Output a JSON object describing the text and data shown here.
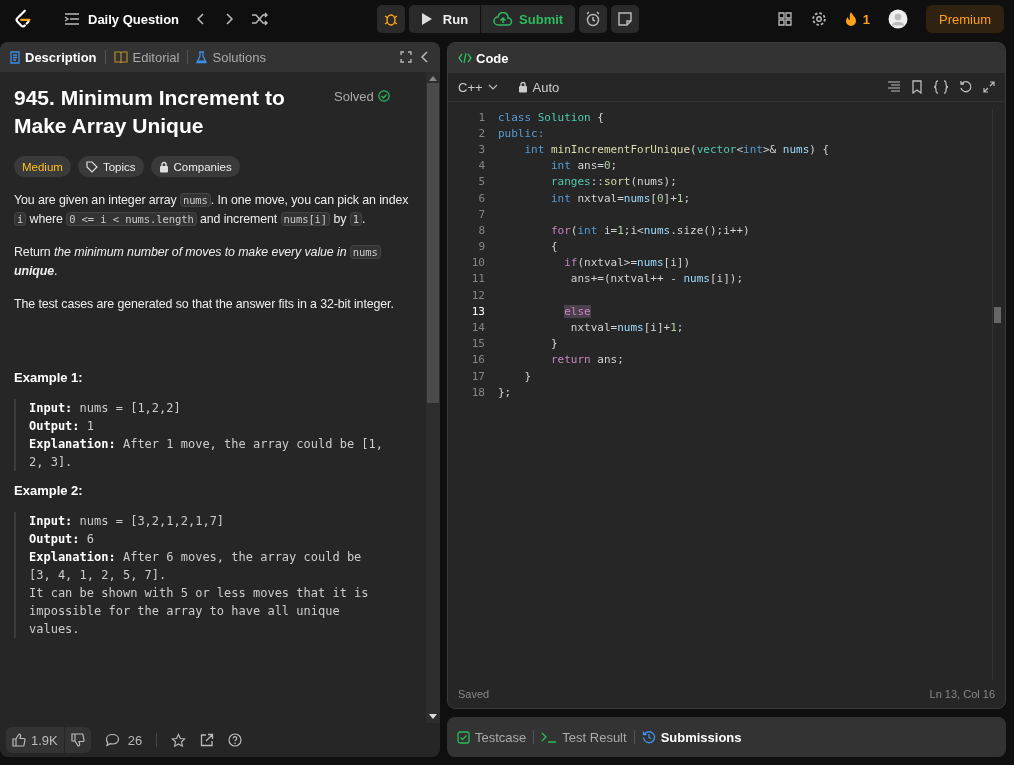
{
  "topbar": {
    "title": "Daily Question",
    "run": "Run",
    "submit": "Submit",
    "streak": "1",
    "premium": "Premium"
  },
  "description": {
    "tabs": [
      {
        "label": "Description",
        "selected": true
      },
      {
        "label": "Editorial",
        "selected": false
      },
      {
        "label": "Solutions",
        "selected": false
      }
    ],
    "title": "945. Minimum Increment to Make Array Unique",
    "status": "Solved",
    "tags": [
      {
        "label": "Medium",
        "kind": "difficulty"
      },
      {
        "label": "Topics",
        "kind": "topic"
      },
      {
        "label": "Companies",
        "kind": "locked"
      }
    ],
    "paragraphs": [
      [
        {
          "t": "You are given an integer array ",
          "kind": "text"
        },
        {
          "t": "nums",
          "kind": "code"
        },
        {
          "t": ". In one move, you can pick an index ",
          "kind": "text"
        },
        {
          "t": "i",
          "kind": "code"
        },
        {
          "t": " where ",
          "kind": "text"
        },
        {
          "t": "0 <= i < nums.length",
          "kind": "code"
        },
        {
          "t": " and increment ",
          "kind": "text"
        },
        {
          "t": "nums[i]",
          "kind": "code"
        },
        {
          "t": " by ",
          "kind": "text"
        },
        {
          "t": "1",
          "kind": "code"
        },
        {
          "t": ".",
          "kind": "text"
        }
      ],
      [
        {
          "t": "Return *the minimum number of moves to make every value in* ",
          "kind": "text"
        },
        {
          "t": "nums",
          "kind": "code"
        },
        {
          "t": " **unique**.",
          "kind": "text"
        }
      ],
      [
        {
          "t": "The test cases are generated so that the answer fits in a 32-bit integer.",
          "kind": "text"
        }
      ]
    ],
    "examples": [
      {
        "title": "Example 1:",
        "lines": [
          {
            "label": "Input:",
            "value": "nums = [1,2,2]"
          },
          {
            "label": "Output:",
            "value": "1"
          },
          {
            "label": "Explanation:",
            "value": "After 1 move, the array could be [1, 2, 3]."
          }
        ]
      },
      {
        "title": "Example 2:",
        "lines": [
          {
            "label": "Input:",
            "value": "nums = [3,2,1,2,1,7]"
          },
          {
            "label": "Output:",
            "value": "6"
          },
          {
            "label": "Explanation:",
            "value": "After 6 moves, the array could be [3, 4, 1, 2, 5, 7].\nIt can be shown with 5 or less moves that it is impossible for the array to have all unique values."
          }
        ]
      }
    ],
    "likes": "1.9K",
    "comments": "26"
  },
  "editor": {
    "title": "Code",
    "language": "C++",
    "mode": "Auto",
    "lines": [
      {
        "n": "1",
        "current": false,
        "tokens": [
          {
            "t": "class",
            "kind": "kw"
          },
          {
            "t": " Solution",
            "kind": "type"
          },
          {
            "t": " {",
            "kind": "plain"
          }
        ]
      },
      {
        "n": "2",
        "current": false,
        "tokens": [
          {
            "t": "public:",
            "kind": "kw"
          }
        ]
      },
      {
        "n": "3",
        "current": false,
        "tokens": [
          {
            "t": "    int",
            "kind": "kw"
          },
          {
            "t": " minIncrementForUnique",
            "kind": "fn"
          },
          {
            "t": "(",
            "kind": "plain"
          },
          {
            "t": "vector",
            "kind": "type"
          },
          {
            "t": "<",
            "kind": "plain"
          },
          {
            "t": "int",
            "kind": "kw"
          },
          {
            "t": ">& ",
            "kind": "plain"
          },
          {
            "t": "nums",
            "kind": "var"
          },
          {
            "t": ") {",
            "kind": "plain"
          }
        ]
      },
      {
        "n": "4",
        "current": false,
        "tokens": [
          {
            "t": "        int",
            "kind": "kw"
          },
          {
            "t": " ans=",
            "kind": "plain"
          },
          {
            "t": "0",
            "kind": "num"
          },
          {
            "t": ";",
            "kind": "plain"
          }
        ]
      },
      {
        "n": "5",
        "current": false,
        "tokens": [
          {
            "t": "        ranges",
            "kind": "type"
          },
          {
            "t": "::",
            "kind": "plain"
          },
          {
            "t": "sort",
            "kind": "fn"
          },
          {
            "t": "(nums);",
            "kind": "plain"
          }
        ]
      },
      {
        "n": "6",
        "current": false,
        "tokens": [
          {
            "t": "        int",
            "kind": "kw"
          },
          {
            "t": " nxtval=",
            "kind": "plain"
          },
          {
            "t": "nums",
            "kind": "var"
          },
          {
            "t": "[",
            "kind": "plain"
          },
          {
            "t": "0",
            "kind": "num"
          },
          {
            "t": "]+",
            "kind": "plain"
          },
          {
            "t": "1",
            "kind": "num"
          },
          {
            "t": ";",
            "kind": "plain"
          }
        ]
      },
      {
        "n": "7",
        "current": false
      },
      {
        "n": "8",
        "current": false,
        "tokens": [
          {
            "t": "        for",
            "kind": "ctrl"
          },
          {
            "t": "(",
            "kind": "plain"
          },
          {
            "t": "int",
            "kind": "kw"
          },
          {
            "t": " i=",
            "kind": "plain"
          },
          {
            "t": "1",
            "kind": "num"
          },
          {
            "t": ";i<",
            "kind": "plain"
          },
          {
            "t": "nums",
            "kind": "var"
          },
          {
            "t": ".size();i++)",
            "kind": "plain"
          }
        ]
      },
      {
        "n": "9",
        "current": false,
        "tokens": [
          {
            "t": "        {",
            "kind": "plain"
          }
        ]
      },
      {
        "n": "10",
        "current": false,
        "tokens": [
          {
            "t": "          if",
            "kind": "ctrl"
          },
          {
            "t": "(nxtval>=",
            "kind": "plain"
          },
          {
            "t": "nums",
            "kind": "var"
          },
          {
            "t": "[i])",
            "kind": "plain"
          }
        ]
      },
      {
        "n": "11",
        "current": false,
        "tokens": [
          {
            "t": "           ans+=(nxtval++ - ",
            "kind": "plain"
          },
          {
            "t": "nums",
            "kind": "var"
          },
          {
            "t": "[i]);",
            "kind": "plain"
          }
        ]
      },
      {
        "n": "12",
        "current": false
      },
      {
        "n": "13",
        "current": true,
        "tokens": [
          {
            "t": "else",
            "kind": "ctrl"
          }
        ]
      },
      {
        "n": "14",
        "current": false,
        "tokens": [
          {
            "t": "           nxtval=",
            "kind": "plain"
          },
          {
            "t": "nums",
            "kind": "var"
          },
          {
            "t": "[i]+",
            "kind": "plain"
          },
          {
            "t": "1",
            "kind": "num"
          },
          {
            "t": ";",
            "kind": "plain"
          }
        ]
      },
      {
        "n": "15",
        "current": false,
        "tokens": [
          {
            "t": "        }",
            "kind": "plain"
          }
        ]
      },
      {
        "n": "16",
        "current": false,
        "tokens": [
          {
            "t": "        return",
            "kind": "ctrl"
          },
          {
            "t": " ans;",
            "kind": "plain"
          }
        ]
      },
      {
        "n": "17",
        "current": false,
        "tokens": [
          {
            "t": "    }",
            "kind": "plain"
          }
        ]
      },
      {
        "n": "18",
        "current": false,
        "tokens": [
          {
            "t": "};",
            "kind": "plain"
          }
        ]
      }
    ],
    "saved": "Saved",
    "cursor": "Ln 13, Col 16"
  },
  "bottom_tabs": [
    {
      "label": "Testcase",
      "kind": "testcase",
      "selected": false
    },
    {
      "label": "Test Result",
      "kind": "result",
      "selected": false
    },
    {
      "label": "Submissions",
      "kind": "submissions",
      "selected": true
    }
  ]
}
